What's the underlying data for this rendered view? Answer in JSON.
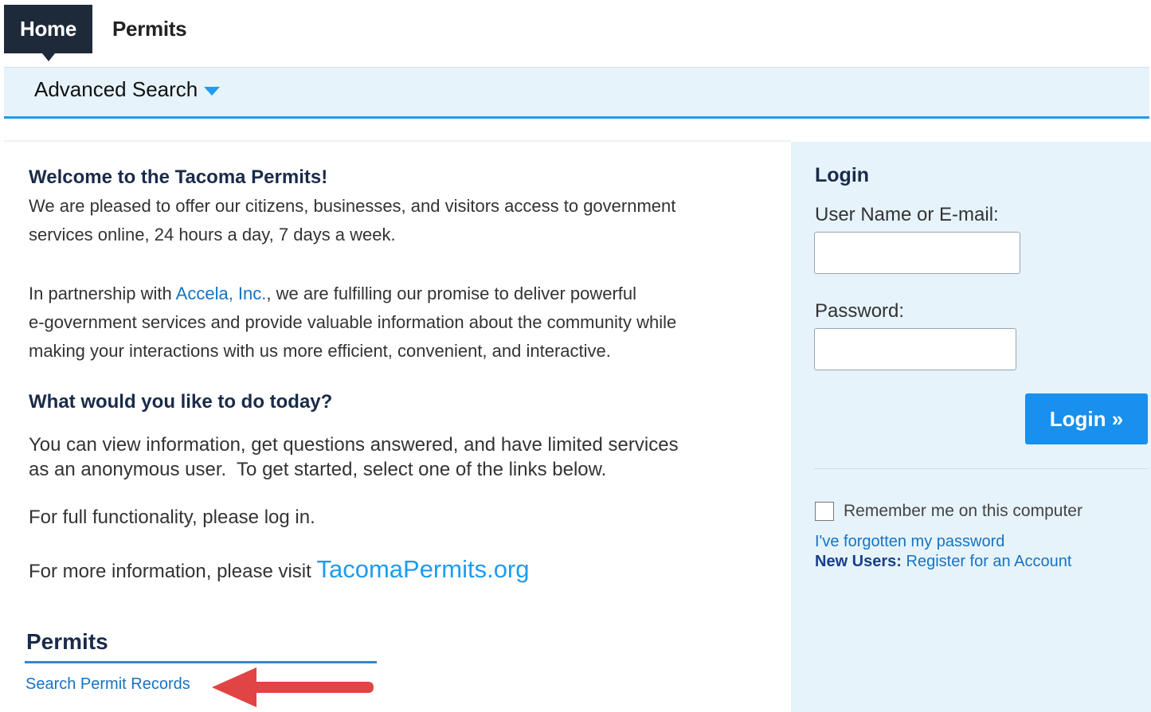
{
  "nav": {
    "tabs": [
      {
        "label": "Home",
        "active": true
      },
      {
        "label": "Permits",
        "active": false
      }
    ],
    "subnav": {
      "label": "Advanced Search"
    }
  },
  "welcome": {
    "title": "Welcome to the Tacoma Permits!",
    "intro_line1": "We are pleased to offer our citizens, businesses, and visitors access to government",
    "intro_line2": "services online, 24 hours a day, 7 days a week.",
    "partner_prefix": "In partnership with ",
    "partner_link": "Accela, Inc.",
    "partner_suffix": ", we are fulfilling our promise to deliver powerful",
    "partner_line2": "e-government services and provide valuable information about the community while",
    "partner_line3": "making your interactions with us more efficient, convenient, and interactive."
  },
  "todo": {
    "title": "What would you like to do today?",
    "line1": "You can view information, get questions answered, and have limited services",
    "line2": "as an anonymous user.  To get started, select one of the links below.",
    "full_functionality": "For full functionality, please log in.",
    "more_info_prefix": "For more information, please visit ",
    "more_info_link": "TacomaPermits.org"
  },
  "permits_section": {
    "heading": "Permits",
    "search_link": "Search Permit Records"
  },
  "login": {
    "title": "Login",
    "username_label": "User Name or E-mail:",
    "username_value": "",
    "password_label": "Password:",
    "password_value": "",
    "button_label": "Login »",
    "remember_label": "Remember me on this computer",
    "remember_checked": false,
    "forgot_link": "I've forgotten my password",
    "new_users_label": "New Users:",
    "register_link": "Register for an Account"
  },
  "colors": {
    "nav_active": "#1e2a3a",
    "accent_blue": "#1d9cf0",
    "link_blue": "#1673c4",
    "panel_bg": "#e6f3fb",
    "annotation_arrow": "#e04444"
  },
  "icons": [
    "caret-down-icon",
    "annotation-arrow-icon"
  ]
}
